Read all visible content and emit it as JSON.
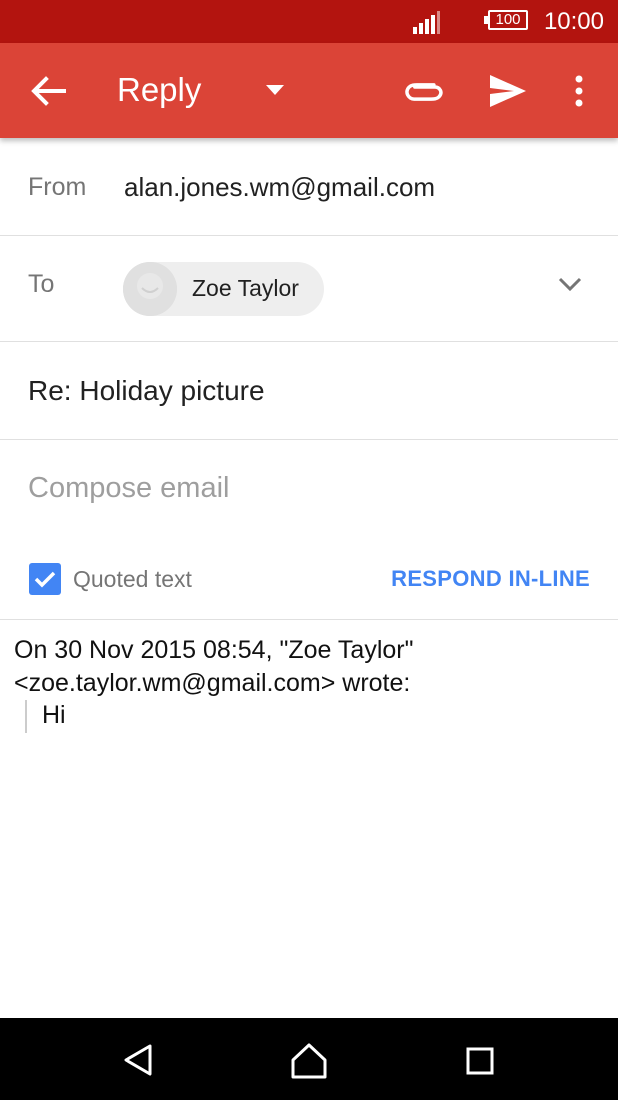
{
  "status_bar": {
    "time": "10:00",
    "battery": "100",
    "signal_icon": "signal-icon"
  },
  "app_bar": {
    "title": "Reply",
    "background": "#db4437",
    "icons": [
      "back-arrow-icon",
      "dropdown-icon",
      "attach-icon",
      "send-icon",
      "more-vert-icon"
    ]
  },
  "from": {
    "label": "From",
    "value": "alan.jones.wm@gmail.com"
  },
  "to": {
    "label": "To",
    "recipient": "Zoe Taylor"
  },
  "subject": {
    "value": "Re: Holiday picture"
  },
  "compose": {
    "placeholder": "Compose email"
  },
  "quoted": {
    "label": "Quoted text",
    "checked": true,
    "respond_label": "RESPOND IN-LINE",
    "accent": "#4285f4"
  },
  "quote": {
    "header_line1": "On 30 Nov 2015 08:54, \"Zoe Taylor\"",
    "header_line2": "<zoe.taylor.wm@gmail.com> wrote:",
    "body": "Hi"
  },
  "nav_bar": {
    "icons": [
      "nav-back-icon",
      "nav-home-icon",
      "nav-recent-icon"
    ]
  }
}
